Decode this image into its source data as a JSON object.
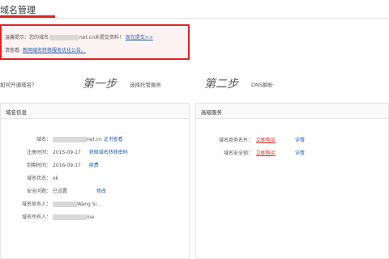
{
  "header": {
    "title": "域名管理"
  },
  "notice": {
    "line1_prefix": "温馨提示：您的域名",
    "line1_domain_suffix": "net.cn未提交资料！",
    "line1_link": "现在提交>>",
    "line2_prefix": "请查看:",
    "line2_link": "新网域名转移服务优化公告。"
  },
  "steps": {
    "question": "如何开通域名？",
    "step1_big": "第一步",
    "step1_text": "选择托管服务",
    "step2_big": "第二步",
    "step2_text": "DNS解析"
  },
  "domain_info": {
    "title": "域名信息",
    "rows": [
      {
        "label": "域名：",
        "value": "net.cn",
        "extra": "证书查看"
      },
      {
        "label": "注册时间：",
        "value": "2015-09-17",
        "extra": "获取域名转移密码"
      },
      {
        "label": "到期时间：",
        "value": "2016-09-17",
        "extra": "续费"
      },
      {
        "label": "域名状态：",
        "value": "ok",
        "extra": ""
      },
      {
        "label": "安全问题：",
        "value": "已设置",
        "extra": "修改"
      },
      {
        "label": "域名联系人：",
        "value": "Wang Si...",
        "extra": ""
      },
      {
        "label": "域名所有人：",
        "value": "ine",
        "extra": ""
      }
    ]
  },
  "advanced": {
    "title": "高级服务",
    "rows": [
      {
        "label": "域名商务名片：",
        "action": "立即购买",
        "detail": "详情"
      },
      {
        "label": "域名安全锁：",
        "action": "立即购买",
        "detail": "详情"
      }
    ]
  }
}
